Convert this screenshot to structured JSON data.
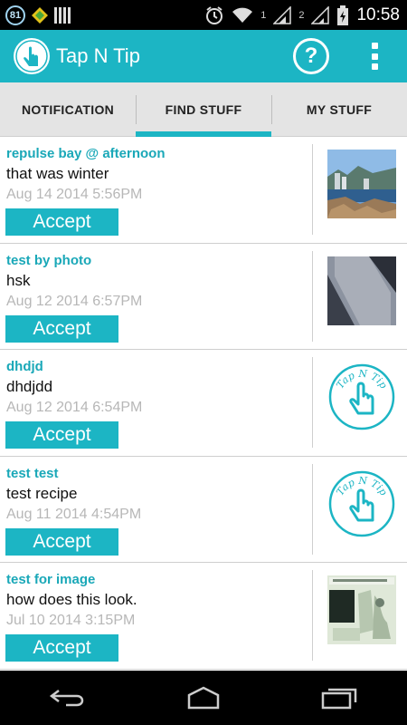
{
  "status_bar": {
    "notification_count": "81",
    "sim1_label": "1",
    "sim2_label": "2",
    "time": "10:58"
  },
  "app_bar": {
    "title": "Tap N Tip",
    "logo_text": "Tap N Tip",
    "help_label": "?",
    "accent_color": "#1cb5c4"
  },
  "tabs": [
    {
      "label": "NOTIFICATION",
      "active": false
    },
    {
      "label": "FIND STUFF",
      "active": true
    },
    {
      "label": "MY STUFF",
      "active": false
    }
  ],
  "items": [
    {
      "title": "repulse bay @ afternoon",
      "desc": "that was winter",
      "date": "Aug 14 2014  5:56PM",
      "button": "Accept",
      "thumb": "photo-beach"
    },
    {
      "title": "test by photo",
      "desc": "hsk",
      "date": "Aug 12 2014  6:57PM",
      "button": "Accept",
      "thumb": "photo-paper"
    },
    {
      "title": "dhdjd",
      "desc": "dhdjdd",
      "date": "Aug 12 2014  6:54PM",
      "button": "Accept",
      "thumb": "tap-n-tip-logo",
      "thumb_text": "Tap N Tip"
    },
    {
      "title": "test test",
      "desc": "test recipe",
      "date": "Aug 11 2014  4:54PM",
      "button": "Accept",
      "thumb": "tap-n-tip-logo",
      "thumb_text": "Tap N Tip"
    },
    {
      "title": "test for image",
      "desc": "how does this look.",
      "date": "Jul 10 2014  3:15PM",
      "button": "Accept",
      "thumb": "photo-sketch"
    }
  ],
  "nav_bar": {
    "back": "back-icon",
    "home": "home-icon",
    "recents": "recents-icon"
  }
}
